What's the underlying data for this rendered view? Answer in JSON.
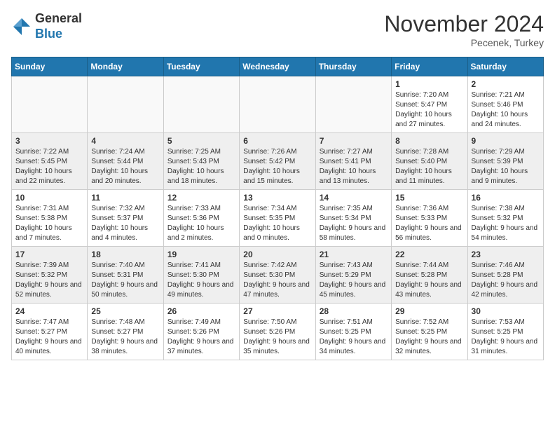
{
  "header": {
    "logo_general": "General",
    "logo_blue": "Blue",
    "month_title": "November 2024",
    "location": "Pecenek, Turkey"
  },
  "days_of_week": [
    "Sunday",
    "Monday",
    "Tuesday",
    "Wednesday",
    "Thursday",
    "Friday",
    "Saturday"
  ],
  "weeks": [
    [
      {
        "day": "",
        "info": ""
      },
      {
        "day": "",
        "info": ""
      },
      {
        "day": "",
        "info": ""
      },
      {
        "day": "",
        "info": ""
      },
      {
        "day": "",
        "info": ""
      },
      {
        "day": "1",
        "info": "Sunrise: 7:20 AM\nSunset: 5:47 PM\nDaylight: 10 hours and 27 minutes."
      },
      {
        "day": "2",
        "info": "Sunrise: 7:21 AM\nSunset: 5:46 PM\nDaylight: 10 hours and 24 minutes."
      }
    ],
    [
      {
        "day": "3",
        "info": "Sunrise: 7:22 AM\nSunset: 5:45 PM\nDaylight: 10 hours and 22 minutes."
      },
      {
        "day": "4",
        "info": "Sunrise: 7:24 AM\nSunset: 5:44 PM\nDaylight: 10 hours and 20 minutes."
      },
      {
        "day": "5",
        "info": "Sunrise: 7:25 AM\nSunset: 5:43 PM\nDaylight: 10 hours and 18 minutes."
      },
      {
        "day": "6",
        "info": "Sunrise: 7:26 AM\nSunset: 5:42 PM\nDaylight: 10 hours and 15 minutes."
      },
      {
        "day": "7",
        "info": "Sunrise: 7:27 AM\nSunset: 5:41 PM\nDaylight: 10 hours and 13 minutes."
      },
      {
        "day": "8",
        "info": "Sunrise: 7:28 AM\nSunset: 5:40 PM\nDaylight: 10 hours and 11 minutes."
      },
      {
        "day": "9",
        "info": "Sunrise: 7:29 AM\nSunset: 5:39 PM\nDaylight: 10 hours and 9 minutes."
      }
    ],
    [
      {
        "day": "10",
        "info": "Sunrise: 7:31 AM\nSunset: 5:38 PM\nDaylight: 10 hours and 7 minutes."
      },
      {
        "day": "11",
        "info": "Sunrise: 7:32 AM\nSunset: 5:37 PM\nDaylight: 10 hours and 4 minutes."
      },
      {
        "day": "12",
        "info": "Sunrise: 7:33 AM\nSunset: 5:36 PM\nDaylight: 10 hours and 2 minutes."
      },
      {
        "day": "13",
        "info": "Sunrise: 7:34 AM\nSunset: 5:35 PM\nDaylight: 10 hours and 0 minutes."
      },
      {
        "day": "14",
        "info": "Sunrise: 7:35 AM\nSunset: 5:34 PM\nDaylight: 9 hours and 58 minutes."
      },
      {
        "day": "15",
        "info": "Sunrise: 7:36 AM\nSunset: 5:33 PM\nDaylight: 9 hours and 56 minutes."
      },
      {
        "day": "16",
        "info": "Sunrise: 7:38 AM\nSunset: 5:32 PM\nDaylight: 9 hours and 54 minutes."
      }
    ],
    [
      {
        "day": "17",
        "info": "Sunrise: 7:39 AM\nSunset: 5:32 PM\nDaylight: 9 hours and 52 minutes."
      },
      {
        "day": "18",
        "info": "Sunrise: 7:40 AM\nSunset: 5:31 PM\nDaylight: 9 hours and 50 minutes."
      },
      {
        "day": "19",
        "info": "Sunrise: 7:41 AM\nSunset: 5:30 PM\nDaylight: 9 hours and 49 minutes."
      },
      {
        "day": "20",
        "info": "Sunrise: 7:42 AM\nSunset: 5:30 PM\nDaylight: 9 hours and 47 minutes."
      },
      {
        "day": "21",
        "info": "Sunrise: 7:43 AM\nSunset: 5:29 PM\nDaylight: 9 hours and 45 minutes."
      },
      {
        "day": "22",
        "info": "Sunrise: 7:44 AM\nSunset: 5:28 PM\nDaylight: 9 hours and 43 minutes."
      },
      {
        "day": "23",
        "info": "Sunrise: 7:46 AM\nSunset: 5:28 PM\nDaylight: 9 hours and 42 minutes."
      }
    ],
    [
      {
        "day": "24",
        "info": "Sunrise: 7:47 AM\nSunset: 5:27 PM\nDaylight: 9 hours and 40 minutes."
      },
      {
        "day": "25",
        "info": "Sunrise: 7:48 AM\nSunset: 5:27 PM\nDaylight: 9 hours and 38 minutes."
      },
      {
        "day": "26",
        "info": "Sunrise: 7:49 AM\nSunset: 5:26 PM\nDaylight: 9 hours and 37 minutes."
      },
      {
        "day": "27",
        "info": "Sunrise: 7:50 AM\nSunset: 5:26 PM\nDaylight: 9 hours and 35 minutes."
      },
      {
        "day": "28",
        "info": "Sunrise: 7:51 AM\nSunset: 5:25 PM\nDaylight: 9 hours and 34 minutes."
      },
      {
        "day": "29",
        "info": "Sunrise: 7:52 AM\nSunset: 5:25 PM\nDaylight: 9 hours and 32 minutes."
      },
      {
        "day": "30",
        "info": "Sunrise: 7:53 AM\nSunset: 5:25 PM\nDaylight: 9 hours and 31 minutes."
      }
    ]
  ]
}
